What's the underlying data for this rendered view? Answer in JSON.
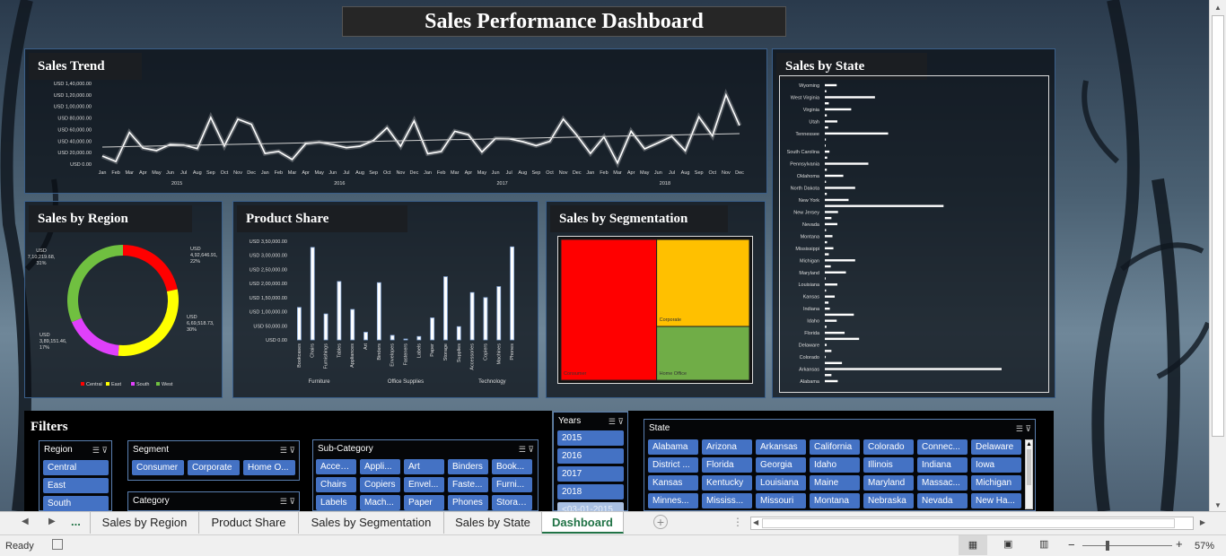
{
  "title": "Sales Performance Dashboard",
  "colors": {
    "central": "#ff0000",
    "east": "#ffff00",
    "south": "#e040fb",
    "west": "#70c040",
    "treemap_consumer": "#ff0000",
    "treemap_corporate": "#ffc000",
    "treemap_home": "#70ad47",
    "slicer": "#4472c4",
    "accent": "#217346"
  },
  "panels": {
    "sales_trend": "Sales Trend",
    "sales_by_state": "Sales by State",
    "sales_by_region": "Sales by Region",
    "product_share": "Product Share",
    "sales_by_segmentation": "Sales by Segmentation"
  },
  "trend": {
    "yticks": [
      "USD 1,40,000.00",
      "USD 1,20,000.00",
      "USD 1,00,000.00",
      "USD 80,000.00",
      "USD 60,000.00",
      "USD 40,000.00",
      "USD 20,000.00",
      "USD 0.00"
    ],
    "ymax": 140000,
    "months": [
      "Jan",
      "Feb",
      "Mar",
      "Apr",
      "May",
      "Jun",
      "Jul",
      "Aug",
      "Sep",
      "Oct",
      "Nov",
      "Dec"
    ],
    "years": [
      "2015",
      "2016",
      "2017",
      "2018"
    ],
    "values": [
      14000,
      4500,
      55000,
      28000,
      23500,
      34000,
      33000,
      27000,
      81000,
      31500,
      78000,
      69000,
      18500,
      22000,
      8000,
      35500,
      38000,
      34000,
      28500,
      31000,
      41000,
      63000,
      31000,
      75000,
      18000,
      22000,
      57000,
      51000,
      21000,
      44500,
      44000,
      39000,
      32000,
      39500,
      78000,
      50000,
      18500,
      47000,
      2000,
      57000,
      26500,
      37000,
      48000,
      23000,
      82000,
      49000,
      120000,
      67000
    ]
  },
  "region": {
    "labels": [
      {
        "text": "USD 4,92,646.91, 22%"
      },
      {
        "text": "USD 6,69,518.73, 30%"
      },
      {
        "text": "USD 3,89,151.46, 17%"
      },
      {
        "text": "USD 7,10,219.68, 31%"
      }
    ],
    "legend": [
      "Central",
      "East",
      "South",
      "West"
    ]
  },
  "chart_data": [
    {
      "type": "line",
      "title": "Sales Trend",
      "x_months": [
        "Jan",
        "Feb",
        "Mar",
        "Apr",
        "May",
        "Jun",
        "Jul",
        "Aug",
        "Sep",
        "Oct",
        "Nov",
        "Dec"
      ],
      "years": [
        "2015",
        "2016",
        "2017",
        "2018"
      ],
      "ylim": [
        0,
        140000
      ],
      "series": [
        {
          "values": [
            14000,
            4500,
            55000,
            28000,
            23500,
            34000,
            33000,
            27000,
            81000,
            31500,
            78000,
            69000,
            18500,
            22000,
            8000,
            35500,
            38000,
            34000,
            28500,
            31000,
            41000,
            63000,
            31000,
            75000,
            18000,
            22000,
            57000,
            51000,
            21000,
            44500,
            44000,
            39000,
            32000,
            39500,
            78000,
            50000,
            18500,
            47000,
            2000,
            57000,
            26500,
            37000,
            48000,
            23000,
            82000,
            49000,
            120000,
            67000
          ]
        }
      ]
    },
    {
      "type": "pie",
      "title": "Sales by Region",
      "categories": [
        "Central",
        "East",
        "South",
        "West"
      ],
      "values": [
        492646.91,
        669518.73,
        389151.46,
        710219.68
      ],
      "percent": [
        22,
        30,
        17,
        31
      ]
    },
    {
      "type": "bar",
      "title": "Product Share",
      "groups": [
        "Furniture",
        "Office Supplies",
        "Technology"
      ],
      "categories": [
        "Bookcases",
        "Chairs",
        "Furnishings",
        "Tables",
        "Appliances",
        "Art",
        "Binders",
        "Envelopes",
        "Fasteners",
        "Labels",
        "Paper",
        "Storage",
        "Supplies",
        "Accessories",
        "Copiers",
        "Machines",
        "Phones"
      ],
      "group_index": [
        0,
        0,
        0,
        0,
        1,
        1,
        1,
        1,
        1,
        1,
        1,
        1,
        1,
        2,
        2,
        2,
        2
      ],
      "values": [
        115000,
        328000,
        92000,
        207000,
        108000,
        27000,
        203000,
        16000,
        3000,
        12000,
        78000,
        224000,
        47000,
        168000,
        150000,
        189000,
        330000
      ],
      "ylim": [
        0,
        350000
      ],
      "yticks": [
        "USD 3,50,000.00",
        "USD 3,00,000.00",
        "USD 2,50,000.00",
        "USD 2,00,000.00",
        "USD 1,50,000.00",
        "USD 1,00,000.00",
        "USD 50,000.00",
        "USD 0.00"
      ]
    },
    {
      "type": "treemap",
      "title": "Sales by Segmentation",
      "categories": [
        "Consumer",
        "Corporate",
        "Home Office"
      ],
      "values": [
        1148060,
        688494,
        424982
      ]
    },
    {
      "type": "bar",
      "orientation": "horizontal",
      "title": "Sales by State",
      "xlim": [
        0,
        100000
      ],
      "categories": [
        "Wyoming",
        "",
        "West Virginia",
        "",
        "Virginia",
        "",
        "Utah",
        "",
        "Tennessee",
        "",
        "",
        "South Carolina",
        "",
        "Pennsylvania",
        "",
        "Oklahoma",
        "",
        "North Dakota",
        "",
        "New York",
        "",
        "New Jersey",
        "",
        "Nevada",
        "",
        "Montana",
        "",
        "Mississippi",
        "",
        "Michigan",
        "",
        "Maryland",
        "",
        "Louisiana",
        "",
        "Kansas",
        "",
        "Indiana",
        "",
        "Idaho",
        "",
        "Florida",
        "",
        "Delaware",
        "",
        "Colorado",
        "",
        "Arkansas",
        "",
        "Alabama"
      ],
      "values": [
        9000,
        1200,
        38000,
        3000,
        20000,
        1500,
        9500,
        2500,
        48000,
        800,
        400,
        3500,
        1800,
        33000,
        1500,
        14000,
        900,
        23000,
        1500,
        18000,
        90000,
        10000,
        5000,
        9500,
        1000,
        5800,
        1700,
        6500,
        3000,
        23000,
        4500,
        16000,
        600,
        9500,
        1000,
        7500,
        2800,
        3800,
        22000,
        9000,
        1300,
        15000,
        26000,
        1400,
        5000,
        700,
        13000,
        134000,
        5000,
        9800,
        1700,
        5200
      ]
    }
  ],
  "filters": {
    "title": "Filters",
    "region": {
      "title": "Region",
      "items": [
        "Central",
        "East",
        "South"
      ]
    },
    "segment": {
      "title": "Segment",
      "items": [
        "Consumer",
        "Corporate",
        "Home O..."
      ]
    },
    "category": {
      "title": "Category"
    },
    "subcategory": {
      "title": "Sub-Category",
      "items": [
        "Acces...",
        "Appli...",
        "Art",
        "Binders",
        "Book...",
        "Chairs",
        "Copiers",
        "Envel...",
        "Faste...",
        "Furni...",
        "Labels",
        "Mach...",
        "Paper",
        "Phones",
        "Storage"
      ]
    },
    "years": {
      "title": "Years",
      "items": [
        "2015",
        "2016",
        "2017",
        "2018",
        "<03-01-2015"
      ]
    },
    "state": {
      "title": "State",
      "items": [
        "Alabama",
        "Arizona",
        "Arkansas",
        "California",
        "Colorado",
        "Connec...",
        "Delaware",
        "District ...",
        "Florida",
        "Georgia",
        "Idaho",
        "Illinois",
        "Indiana",
        "Iowa",
        "Kansas",
        "Kentucky",
        "Louisiana",
        "Maine",
        "Maryland",
        "Massac...",
        "Michigan",
        "Minnes...",
        "Mississ...",
        "Missouri",
        "Montana",
        "Nebraska",
        "Nevada",
        "New Ha..."
      ]
    }
  },
  "tabs": {
    "ellipsis": "...",
    "items": [
      "Sales by Region",
      "Product Share",
      "Sales by Segmentation",
      "Sales by State",
      "Dashboard"
    ],
    "active": "Dashboard"
  },
  "status": {
    "ready": "Ready",
    "zoom": "57%"
  }
}
